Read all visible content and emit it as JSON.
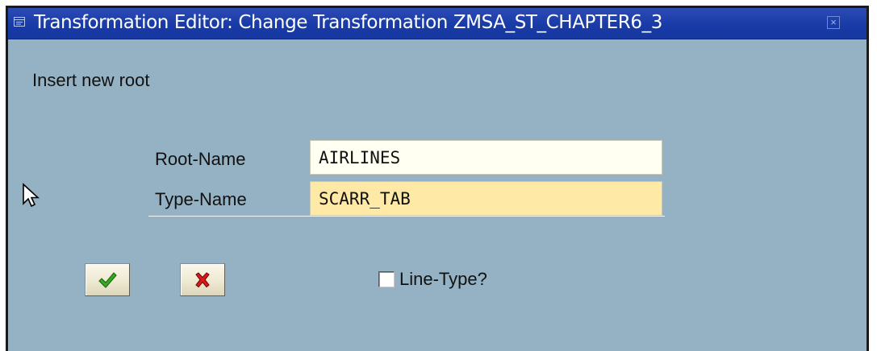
{
  "window": {
    "title": "Transformation Editor: Change Transformation ZMSA_ST_CHAPTER6_3",
    "title_icon": "window-icon",
    "close_icon": "close-icon"
  },
  "dialog": {
    "header": "Insert new root",
    "fields": {
      "root_name_label": "Root-Name",
      "root_name_value": "AIRLINES",
      "type_name_label": "Type-Name",
      "type_name_value": "SCARR_TAB"
    },
    "buttons": {
      "ok_icon": "checkmark-icon",
      "cancel_icon": "cross-icon"
    },
    "line_type": {
      "label": "Line-Type?",
      "checked": false
    }
  },
  "colors": {
    "titlebar": "#1d3faa",
    "dialog_background": "#94b2c4",
    "required_field": "#ffe9a6",
    "field_background": "#fffff2",
    "ok_green": "#2e9e1a",
    "cancel_red": "#d01818"
  }
}
